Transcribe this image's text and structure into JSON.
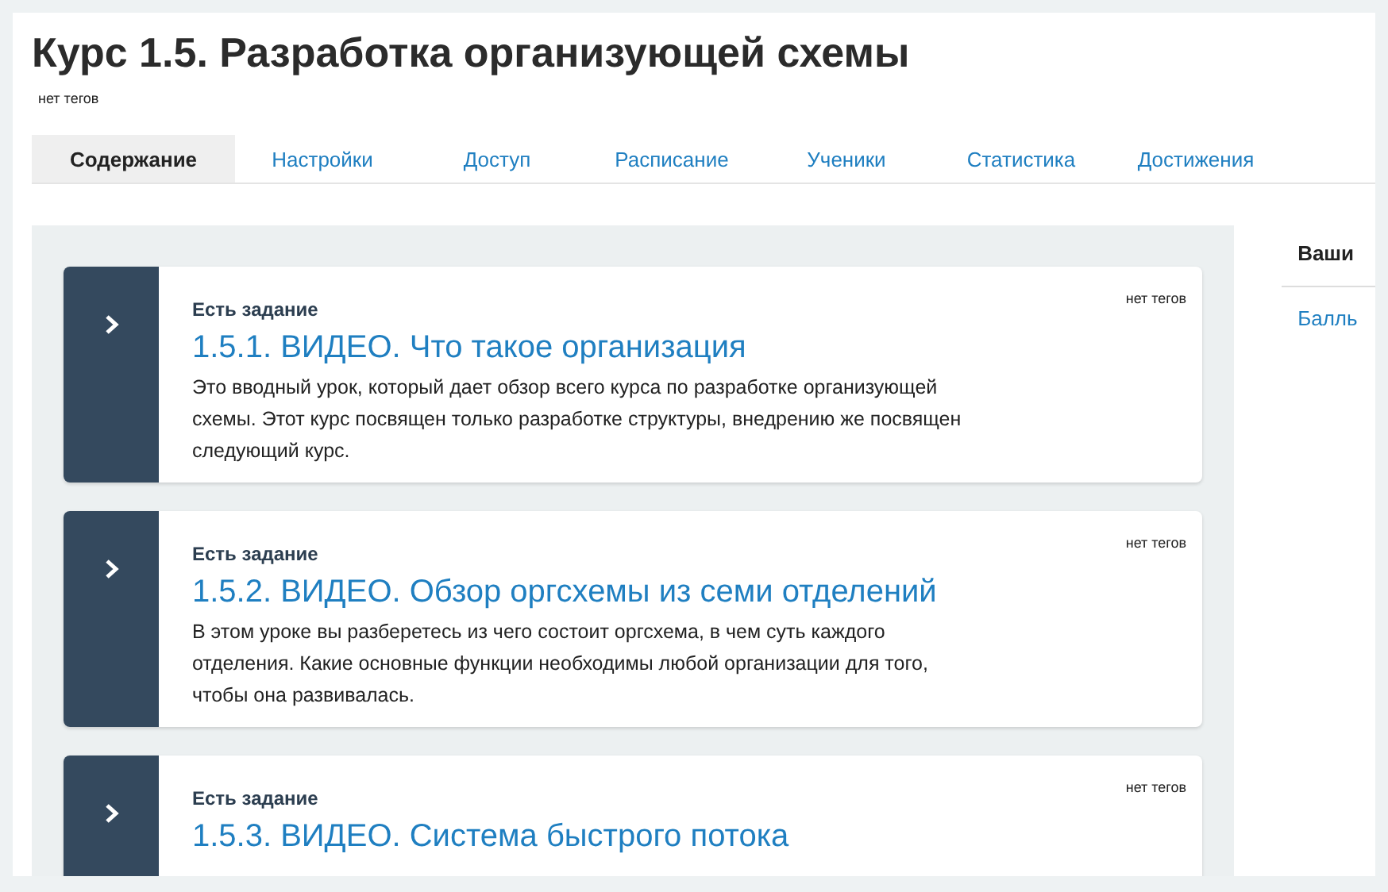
{
  "title": "Курс 1.5. Разработка организующей схемы",
  "tags": "нет тегов",
  "tabs": [
    {
      "label": "Содержание",
      "selected": true
    },
    {
      "label": "Настройки",
      "selected": false
    },
    {
      "label": "Доступ",
      "selected": false
    },
    {
      "label": "Расписание",
      "selected": false
    },
    {
      "label": "Ученики",
      "selected": false
    },
    {
      "label": "Статистика",
      "selected": false
    },
    {
      "label": "Достижения",
      "selected": false
    }
  ],
  "lessons": [
    {
      "status": "Есть задание",
      "title": "1.5.1. ВИДЕО. Что такое организация",
      "tags": "нет тегов",
      "description": "Это вводный урок, который дает обзор всего курса по разработке организующей схемы. Этот курс посвящен только разработке структуры, внедрению же посвящен следующий курс."
    },
    {
      "status": "Есть задание",
      "title": "1.5.2. ВИДЕО. Обзор оргсхемы из семи отделений",
      "tags": "нет тегов",
      "description": "В этом уроке вы разберетесь из чего состоит оргсхема, в чем суть каждого отделения. Какие основные функции необходимы любой организации для того, чтобы она развивалась."
    },
    {
      "status": "Есть задание",
      "title": "1.5.3. ВИДЕО. Система быстрого потока",
      "tags": "нет тегов"
    }
  ],
  "sidebar": {
    "heading": "Ваши",
    "link": "Балль"
  }
}
